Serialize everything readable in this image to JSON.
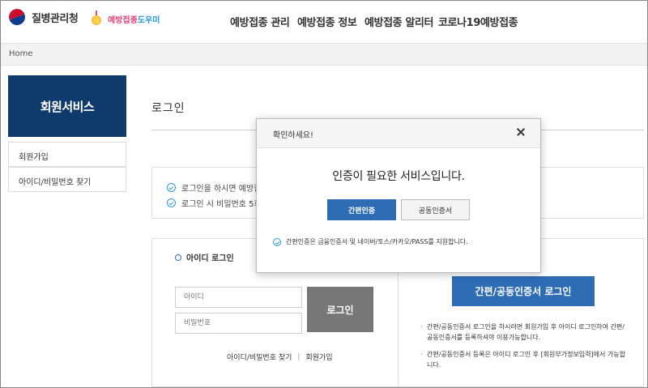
{
  "header": {
    "logo_kdca": "질병관리청",
    "logo_helper_a": "예방접종",
    "logo_helper_b": "도우미",
    "nav": [
      "예방접종 관리",
      "예방접종 정보",
      "예방접종 알리터",
      "코로나19예방접종"
    ]
  },
  "breadcrumb": "Home",
  "sidebar": {
    "title": "회원서비스",
    "items": [
      "회원가입",
      "아이디/비밀번호 찾기"
    ]
  },
  "main": {
    "heading": "로그인",
    "notices": [
      "로그인을 하시면 예방접종",
      "로그인 시 비밀번호 5회 이"
    ],
    "id_login": {
      "title": "아이디 로그인",
      "id_placeholder": "아이디",
      "pw_placeholder": "비밀번호",
      "login_button": "로그인",
      "find_link": "아이디/비밀번호 찾기",
      "separator": "|",
      "join_link": "회원가입"
    },
    "cert_login": {
      "button": "간편/공동인증서 로그인",
      "note1a": "간편/공동인증서 로그인을 하시려면 회원가입 후 아이디 로그인하여 간편/",
      "note1b": "공동인증서를 등록하셔야 이용가능합니다.",
      "note2a": "간편/공동인증서 등록은 아이디 로그인 후 [회원부가정보입력]에서 가능합",
      "note2b": "니다."
    }
  },
  "modal": {
    "title": "확인하세요!",
    "message": "인증이 필요한 서비스입니다.",
    "btn_simple": "간편인증",
    "btn_cert": "공동인증서",
    "note": "간편인증은 금융인증서 및 네이버/토스/카카오/PASS를 지원합니다."
  },
  "colors": {
    "navy": "#0e3b6b",
    "accent_blue": "#2e6cb3",
    "gray_button": "#777777"
  }
}
